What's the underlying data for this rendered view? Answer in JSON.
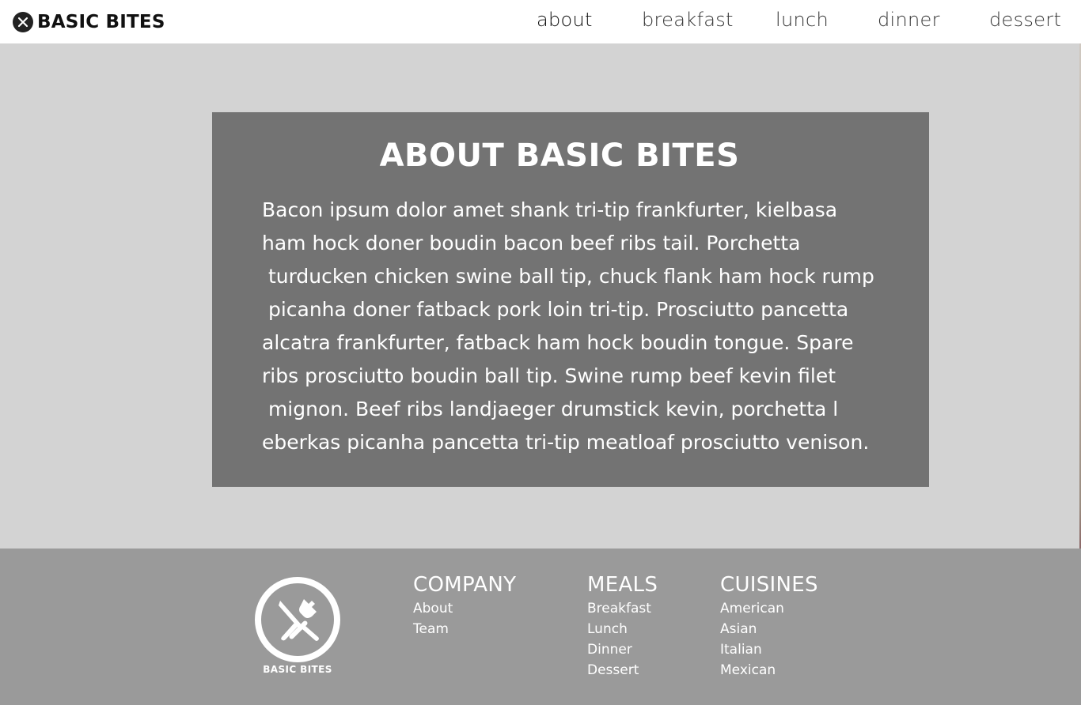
{
  "brand": {
    "name": "BASIC BITES",
    "icon": "fork-knife-icon"
  },
  "nav": {
    "items": [
      {
        "label": "about",
        "active": true
      },
      {
        "label": "breakfast",
        "active": false
      },
      {
        "label": "lunch",
        "active": false
      },
      {
        "label": "dinner",
        "active": false
      },
      {
        "label": "dessert",
        "active": false
      }
    ]
  },
  "about": {
    "title": "ABOUT BASIC BITES",
    "lines": [
      "Bacon ipsum dolor amet shank tri-tip frankfurter, kielbasa",
      "ham hock doner boudin bacon beef ribs tail. Porchetta",
      " turducken chicken swine ball tip, chuck flank ham hock rump",
      " picanha doner fatback pork loin tri-tip. Prosciutto pancetta",
      "alcatra frankfurter, fatback ham hock boudin tongue. Spare",
      "ribs prosciutto boudin ball tip. Swine rump beef kevin filet",
      " mignon. Beef ribs landjaeger drumstick kevin, porchetta l",
      "eberkas picanha pancetta tri-tip meatloaf prosciutto venison."
    ]
  },
  "footer": {
    "logo_text": "BASIC BITES",
    "columns": [
      {
        "heading": "COMPANY",
        "links": [
          "About",
          "Team"
        ]
      },
      {
        "heading": "MEALS",
        "links": [
          "Breakfast",
          "Lunch",
          "Dinner",
          "Dessert"
        ]
      },
      {
        "heading": "CUISINES",
        "links": [
          "American",
          "Asian",
          "Italian",
          "Mexican"
        ]
      }
    ]
  },
  "colors": {
    "navbar_bg": "#ffffff",
    "page_bg": "#d3d3d3",
    "about_box_bg": "#737373",
    "footer_bg": "#9a9a9a",
    "text_light": "#ffffff"
  }
}
